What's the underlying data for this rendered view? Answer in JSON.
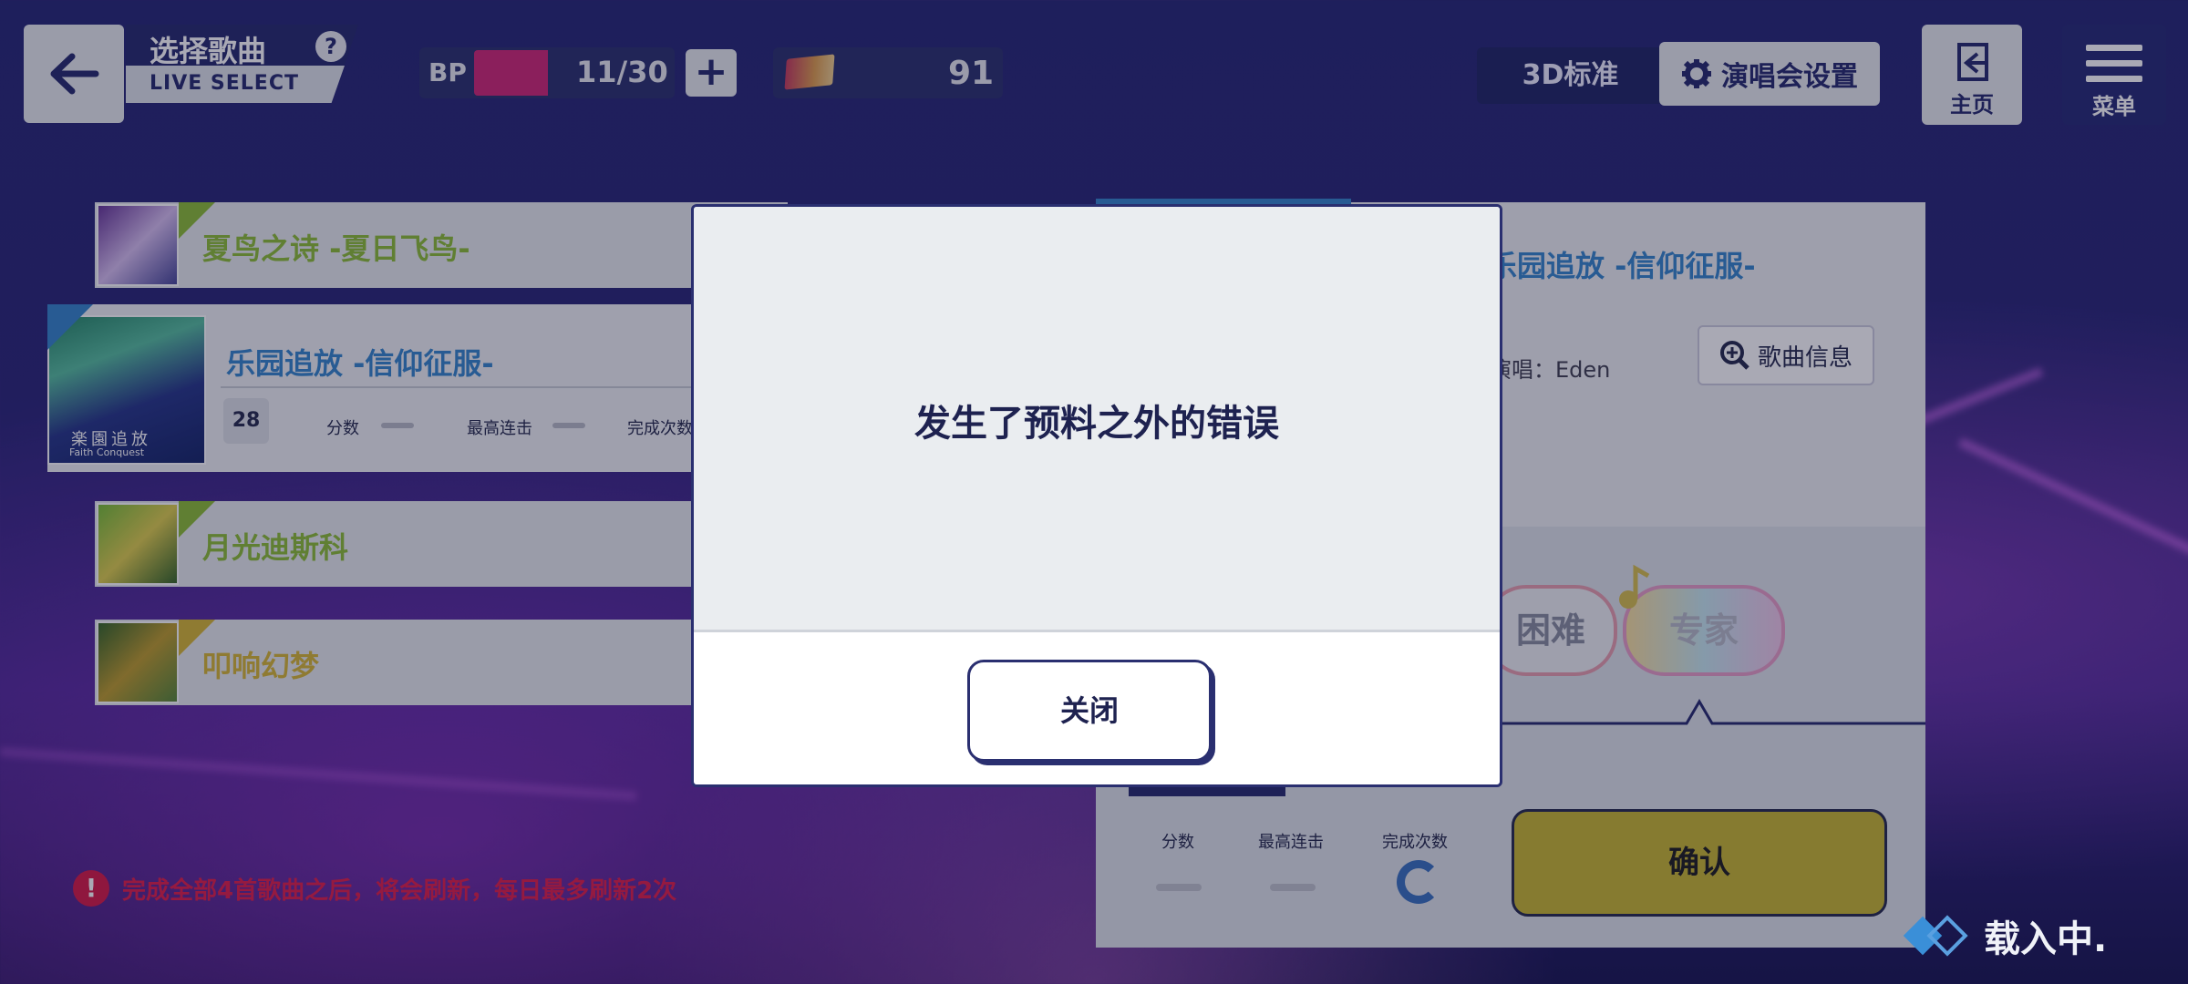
{
  "header": {
    "title_zh": "选择歌曲",
    "title_en": "LIVE SELECT",
    "help": "?",
    "bp_label": "BP",
    "bp_value": "11/30",
    "bp_fill_fraction": 0.37,
    "bp_plus": "+",
    "currency_value": "91",
    "mode_label": "3D标准",
    "settings_label": "演唱会设置",
    "home_label": "主页",
    "menu_label": "菜单"
  },
  "songs": [
    {
      "name": "夏鸟之诗 -夏日飞鸟-",
      "color": "#8fbf3a"
    },
    {
      "name": "乐园追放 -信仰征服-",
      "color": "#3a88cc",
      "level": "28",
      "stat_score": "分数",
      "stat_combo": "最高连击",
      "stat_clears": "完成次数",
      "jacket_text": "楽園追放",
      "jacket_sub": "Faith Conquest"
    },
    {
      "name": "月光迪斯科",
      "color": "#8fbf3a"
    },
    {
      "name": "叩响幻梦",
      "color": "#d8b838"
    }
  ],
  "detail": {
    "title": "乐园追放 -信仰征服-",
    "singer": "演唱：Eden",
    "info_label": "歌曲信息",
    "difficulty_hard": "困难",
    "difficulty_expert": "专家",
    "stat_score": "分数",
    "stat_combo": "最高连击",
    "stat_clears": "完成次数",
    "confirm_label": "确认"
  },
  "warning": {
    "icon": "!",
    "text": "完成全部4首歌曲之后，将会刷新，每日最多刷新2次"
  },
  "loading_text": "载入中.",
  "modal": {
    "message": "发生了预料之外的错误",
    "close_label": "关闭"
  }
}
